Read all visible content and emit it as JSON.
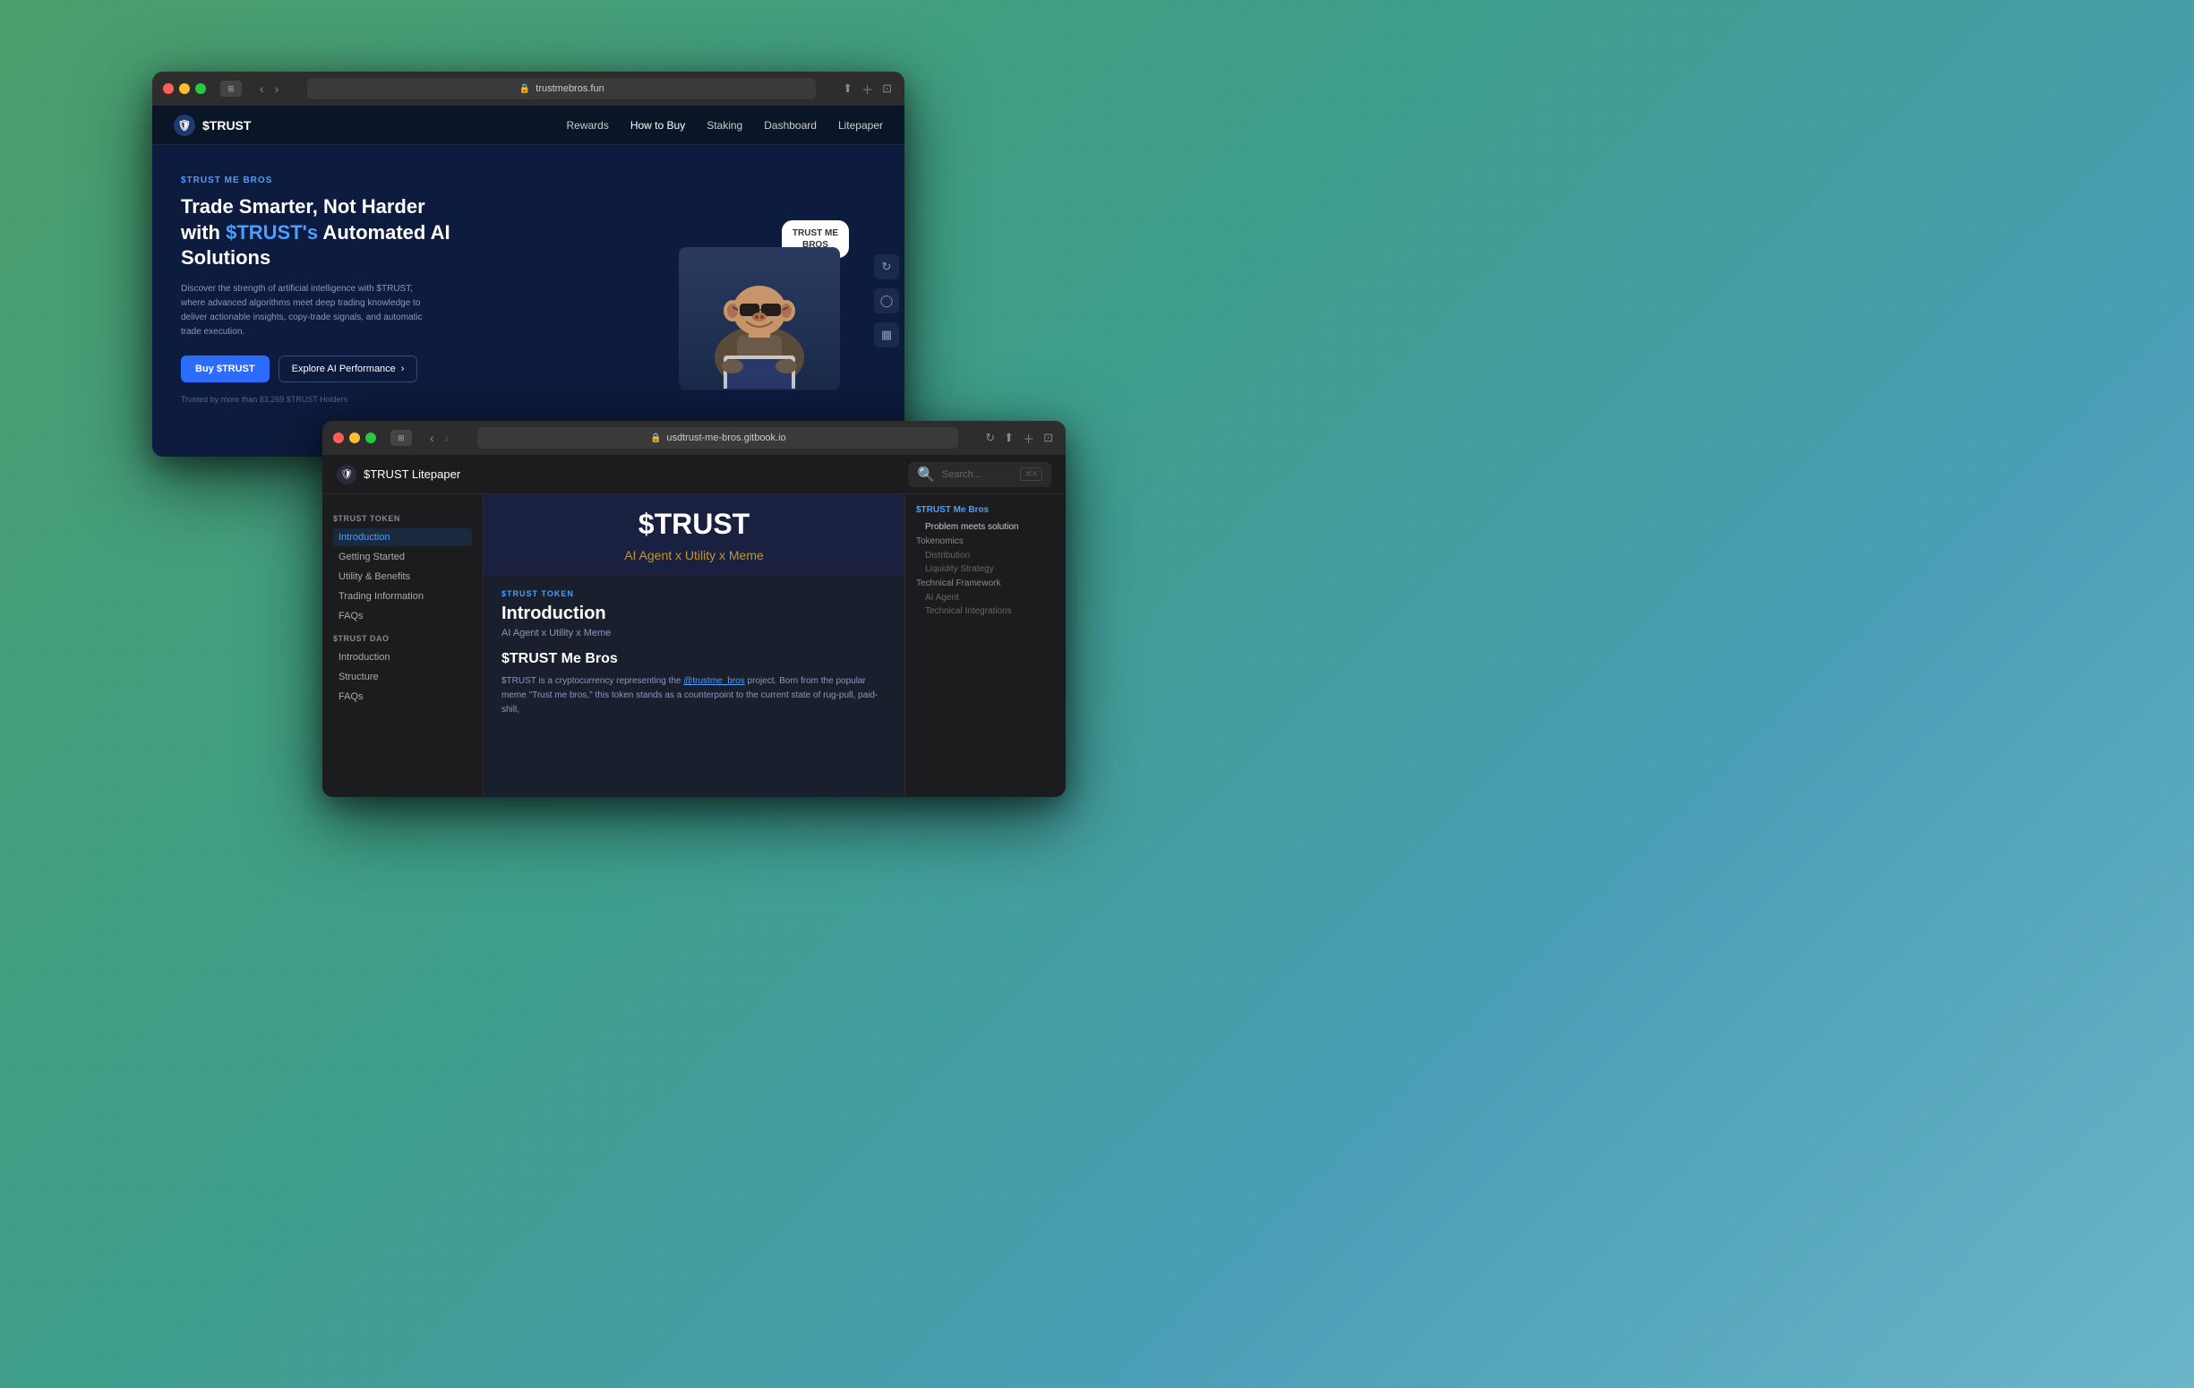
{
  "desktop": {
    "bg_color_start": "#4a9e6b",
    "bg_color_end": "#6ab5c8"
  },
  "window_back": {
    "titlebar": {
      "url": "trustmebros.fun",
      "tab_icon": "🛡"
    },
    "navbar": {
      "logo": "$TRUST",
      "links": [
        "Rewards",
        "How to Buy",
        "Staking",
        "Dashboard",
        "Litepaper"
      ]
    },
    "hero": {
      "badge": "$TRUST ME BROS",
      "title_part1": "Trade Smarter, Not Harder",
      "title_part2": "with ",
      "title_highlight": "$TRUST's",
      "title_part3": " Automated AI",
      "title_part4": "Solutions",
      "description": "Discover the strength of artificial intelligence with $TRUST, where advanced algorithms meet deep trading knowledge to deliver actionable insights, copy-trade signals, and automatic trade execution.",
      "btn_primary": "Buy $TRUST",
      "btn_secondary": "Explore AI Performance",
      "trust_text": "Trusted by more than 83,269 $TRUST Holders",
      "speech_bubble_line1": "TRUST ME",
      "speech_bubble_line2": "BROS"
    },
    "side_icons": [
      "↻",
      "◯",
      "▦"
    ]
  },
  "window_front": {
    "titlebar": {
      "url": "usdtrust-me-bros.gitbook.io",
      "tab_icon": "🛡"
    },
    "header": {
      "logo": "$TRUST Litepaper",
      "search_placeholder": "Search...",
      "search_shortcut": "⌘K"
    },
    "sidebar": {
      "section1": {
        "title": "$TRUST TOKEN",
        "items": [
          {
            "label": "Introduction",
            "active": true
          },
          {
            "label": "Getting Started",
            "active": false
          },
          {
            "label": "Utility & Benefits",
            "active": false
          },
          {
            "label": "Trading Information",
            "active": false
          },
          {
            "label": "FAQs",
            "active": false
          }
        ]
      },
      "section2": {
        "title": "$TRUST DAO",
        "items": [
          {
            "label": "Introduction",
            "active": false
          },
          {
            "label": "Structure",
            "active": false
          },
          {
            "label": "FAQs",
            "active": false
          }
        ]
      }
    },
    "main": {
      "hero_title": "$TRUST",
      "hero_subtitle": "AI Agent x Utility x Meme",
      "article_badge": "$TRUST TOKEN",
      "article_title": "Introduction",
      "article_subtitle": "AI Agent x Utility x Meme",
      "section_title": "$TRUST Me Bros",
      "article_text": "$TRUST is a cryptocurrency representing the ",
      "article_link_text": "@trustme_bros",
      "article_text2": " project. Born from the popular meme \"Trust me bros,\" this token stands as a counterpoint to the current state of rug-pull, paid-shill,"
    },
    "toc": {
      "section_title": "$TRUST Me Bros",
      "items": [
        {
          "label": "Problem meets solution",
          "indent": true
        },
        {
          "label": "Tokenomics",
          "indent": false
        },
        {
          "label": "Distribution",
          "indent": true
        },
        {
          "label": "Liquidity Strategy",
          "indent": true
        },
        {
          "label": "Technical Framework",
          "indent": false
        },
        {
          "label": "AI Agent",
          "indent": true
        },
        {
          "label": "Technical Integrations",
          "indent": true
        }
      ]
    }
  }
}
